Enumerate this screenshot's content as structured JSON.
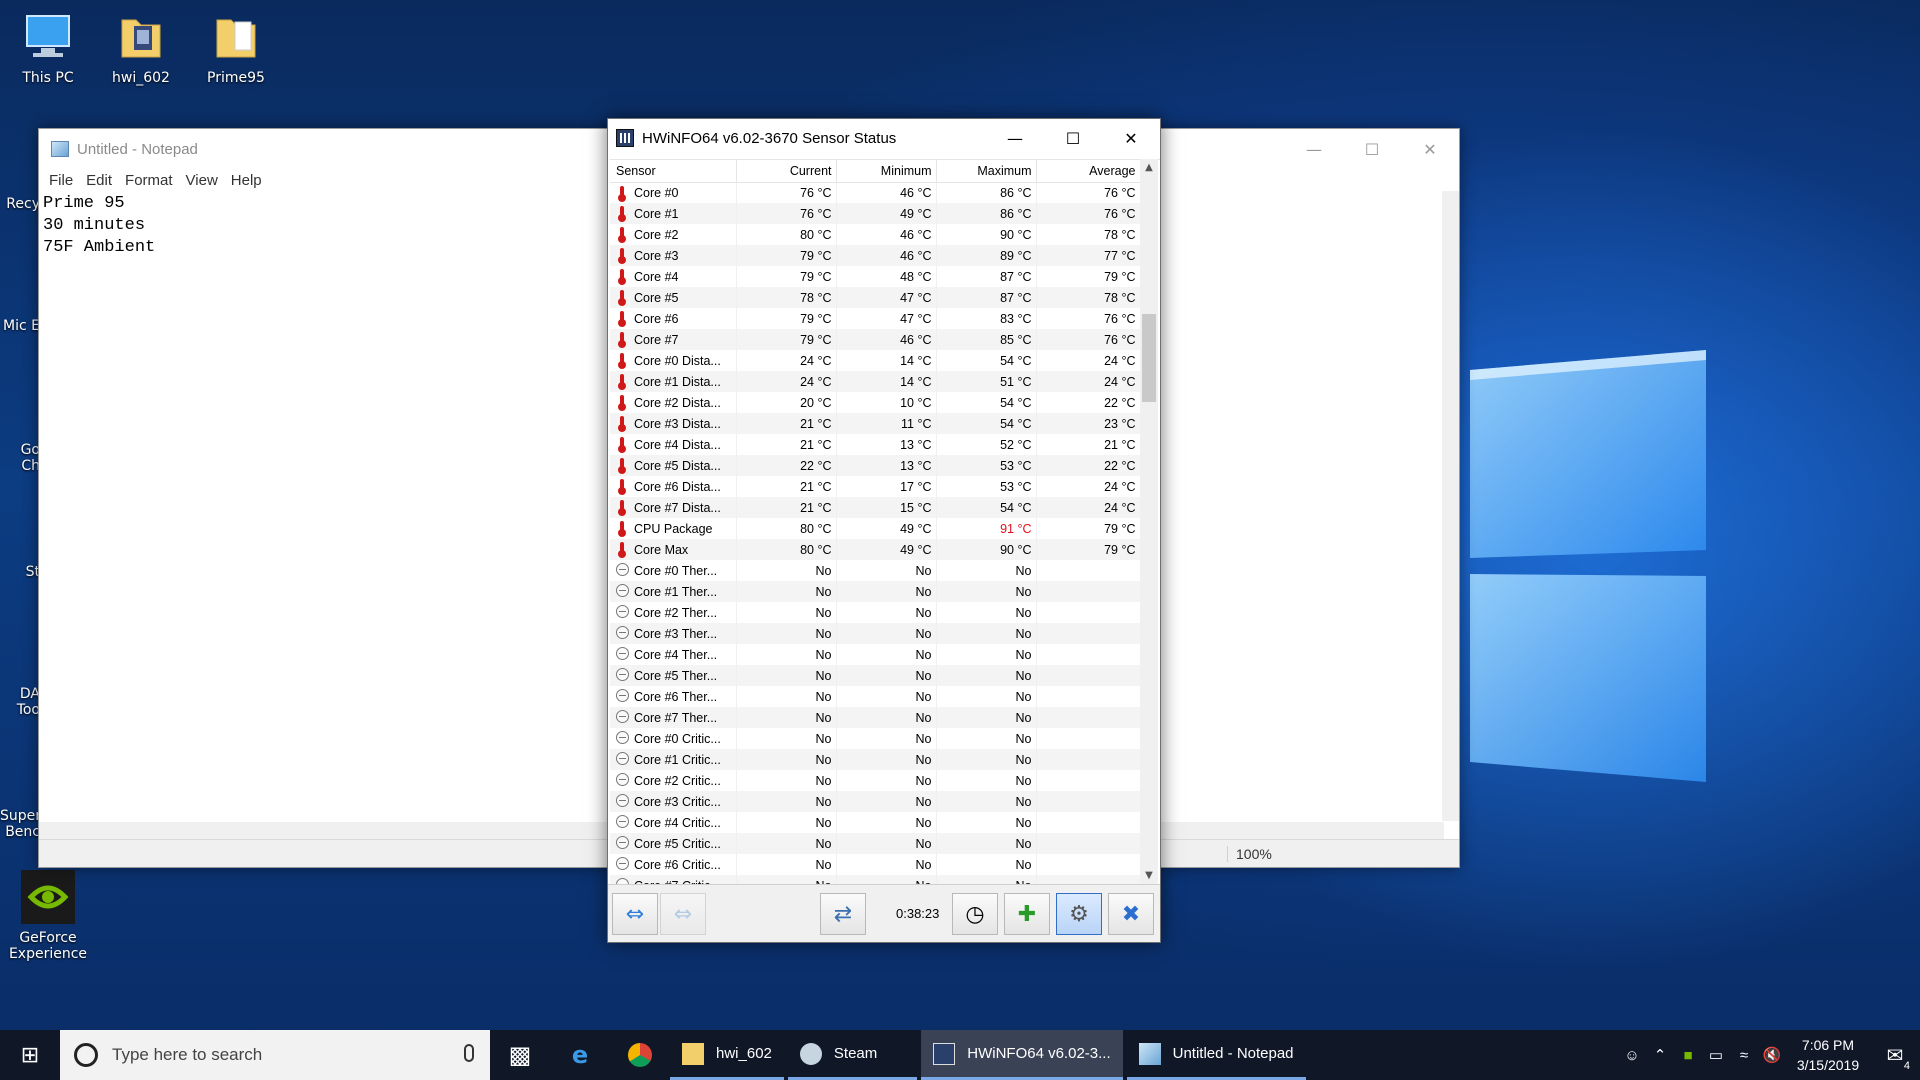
{
  "desktop": {
    "icons": [
      {
        "label": "This PC"
      },
      {
        "label": "hwi_602"
      },
      {
        "label": "Prime95"
      },
      {
        "label": "GeForce Experience"
      }
    ],
    "partial_labels": [
      "Recy",
      "Mic E",
      "Go Ch",
      "St",
      "DA Too",
      "Super Benc"
    ]
  },
  "notepad": {
    "title": "Untitled - Notepad",
    "menu": [
      "File",
      "Edit",
      "Format",
      "View",
      "Help"
    ],
    "content": "Prime 95\n30 minutes\n75F Ambient",
    "zoom": "100%"
  },
  "hwinfo": {
    "title": "HWiNFO64 v6.02-3670 Sensor Status",
    "columns": {
      "sensor": "Sensor",
      "current": "Current",
      "minimum": "Minimum",
      "maximum": "Maximum",
      "average": "Average"
    },
    "rows": [
      {
        "icon": "thermometer",
        "name": "Core #0",
        "current": "76 °C",
        "min": "46 °C",
        "max": "86 °C",
        "avg": "76 °C"
      },
      {
        "icon": "thermometer",
        "name": "Core #1",
        "current": "76 °C",
        "min": "49 °C",
        "max": "86 °C",
        "avg": "76 °C"
      },
      {
        "icon": "thermometer",
        "name": "Core #2",
        "current": "80 °C",
        "min": "46 °C",
        "max": "90 °C",
        "avg": "78 °C"
      },
      {
        "icon": "thermometer",
        "name": "Core #3",
        "current": "79 °C",
        "min": "46 °C",
        "max": "89 °C",
        "avg": "77 °C"
      },
      {
        "icon": "thermometer",
        "name": "Core #4",
        "current": "79 °C",
        "min": "48 °C",
        "max": "87 °C",
        "avg": "79 °C"
      },
      {
        "icon": "thermometer",
        "name": "Core #5",
        "current": "78 °C",
        "min": "47 °C",
        "max": "87 °C",
        "avg": "78 °C"
      },
      {
        "icon": "thermometer",
        "name": "Core #6",
        "current": "79 °C",
        "min": "47 °C",
        "max": "83 °C",
        "avg": "76 °C"
      },
      {
        "icon": "thermometer",
        "name": "Core #7",
        "current": "79 °C",
        "min": "46 °C",
        "max": "85 °C",
        "avg": "76 °C"
      },
      {
        "icon": "thermometer",
        "name": "Core #0 Dista...",
        "current": "24 °C",
        "min": "14 °C",
        "max": "54 °C",
        "avg": "24 °C"
      },
      {
        "icon": "thermometer",
        "name": "Core #1 Dista...",
        "current": "24 °C",
        "min": "14 °C",
        "max": "51 °C",
        "avg": "24 °C"
      },
      {
        "icon": "thermometer",
        "name": "Core #2 Dista...",
        "current": "20 °C",
        "min": "10 °C",
        "max": "54 °C",
        "avg": "22 °C"
      },
      {
        "icon": "thermometer",
        "name": "Core #3 Dista...",
        "current": "21 °C",
        "min": "11 °C",
        "max": "54 °C",
        "avg": "23 °C"
      },
      {
        "icon": "thermometer",
        "name": "Core #4 Dista...",
        "current": "21 °C",
        "min": "13 °C",
        "max": "52 °C",
        "avg": "21 °C"
      },
      {
        "icon": "thermometer",
        "name": "Core #5 Dista...",
        "current": "22 °C",
        "min": "13 °C",
        "max": "53 °C",
        "avg": "22 °C"
      },
      {
        "icon": "thermometer",
        "name": "Core #6 Dista...",
        "current": "21 °C",
        "min": "17 °C",
        "max": "53 °C",
        "avg": "24 °C"
      },
      {
        "icon": "thermometer",
        "name": "Core #7 Dista...",
        "current": "21 °C",
        "min": "15 °C",
        "max": "54 °C",
        "avg": "24 °C"
      },
      {
        "icon": "thermometer",
        "name": "CPU Package",
        "current": "80 °C",
        "min": "49 °C",
        "max": "91 °C",
        "avg": "79 °C",
        "max_highlight": true
      },
      {
        "icon": "thermometer",
        "name": "Core Max",
        "current": "80 °C",
        "min": "49 °C",
        "max": "90 °C",
        "avg": "79 °C"
      },
      {
        "icon": "status",
        "name": "Core #0 Ther...",
        "current": "No",
        "min": "No",
        "max": "No",
        "avg": ""
      },
      {
        "icon": "status",
        "name": "Core #1 Ther...",
        "current": "No",
        "min": "No",
        "max": "No",
        "avg": ""
      },
      {
        "icon": "status",
        "name": "Core #2 Ther...",
        "current": "No",
        "min": "No",
        "max": "No",
        "avg": ""
      },
      {
        "icon": "status",
        "name": "Core #3 Ther...",
        "current": "No",
        "min": "No",
        "max": "No",
        "avg": ""
      },
      {
        "icon": "status",
        "name": "Core #4 Ther...",
        "current": "No",
        "min": "No",
        "max": "No",
        "avg": ""
      },
      {
        "icon": "status",
        "name": "Core #5 Ther...",
        "current": "No",
        "min": "No",
        "max": "No",
        "avg": ""
      },
      {
        "icon": "status",
        "name": "Core #6 Ther...",
        "current": "No",
        "min": "No",
        "max": "No",
        "avg": ""
      },
      {
        "icon": "status",
        "name": "Core #7 Ther...",
        "current": "No",
        "min": "No",
        "max": "No",
        "avg": ""
      },
      {
        "icon": "status",
        "name": "Core #0 Critic...",
        "current": "No",
        "min": "No",
        "max": "No",
        "avg": ""
      },
      {
        "icon": "status",
        "name": "Core #1 Critic...",
        "current": "No",
        "min": "No",
        "max": "No",
        "avg": ""
      },
      {
        "icon": "status",
        "name": "Core #2 Critic...",
        "current": "No",
        "min": "No",
        "max": "No",
        "avg": ""
      },
      {
        "icon": "status",
        "name": "Core #3 Critic...",
        "current": "No",
        "min": "No",
        "max": "No",
        "avg": ""
      },
      {
        "icon": "status",
        "name": "Core #4 Critic...",
        "current": "No",
        "min": "No",
        "max": "No",
        "avg": ""
      },
      {
        "icon": "status",
        "name": "Core #5 Critic...",
        "current": "No",
        "min": "No",
        "max": "No",
        "avg": ""
      },
      {
        "icon": "status",
        "name": "Core #6 Critic...",
        "current": "No",
        "min": "No",
        "max": "No",
        "avg": ""
      },
      {
        "icon": "status",
        "name": "Core #7 Critic...",
        "current": "No",
        "min": "No",
        "max": "No",
        "avg": ""
      }
    ],
    "elapsed": "0:38:23",
    "colors": {
      "highlight": "#e0101a",
      "thermometer": "#d01818"
    }
  },
  "taskbar": {
    "search_placeholder": "Type here to search",
    "apps": [
      {
        "label": "hwi_602",
        "icon": "folder-icon"
      },
      {
        "label": "Steam",
        "icon": "steam-icon"
      },
      {
        "label": "HWiNFO64 v6.02-3...",
        "icon": "hwinfo-icon"
      },
      {
        "label": "Untitled - Notepad",
        "icon": "notepad-icon"
      }
    ],
    "time": "7:06 PM",
    "date": "3/15/2019",
    "notification_count": "4"
  }
}
